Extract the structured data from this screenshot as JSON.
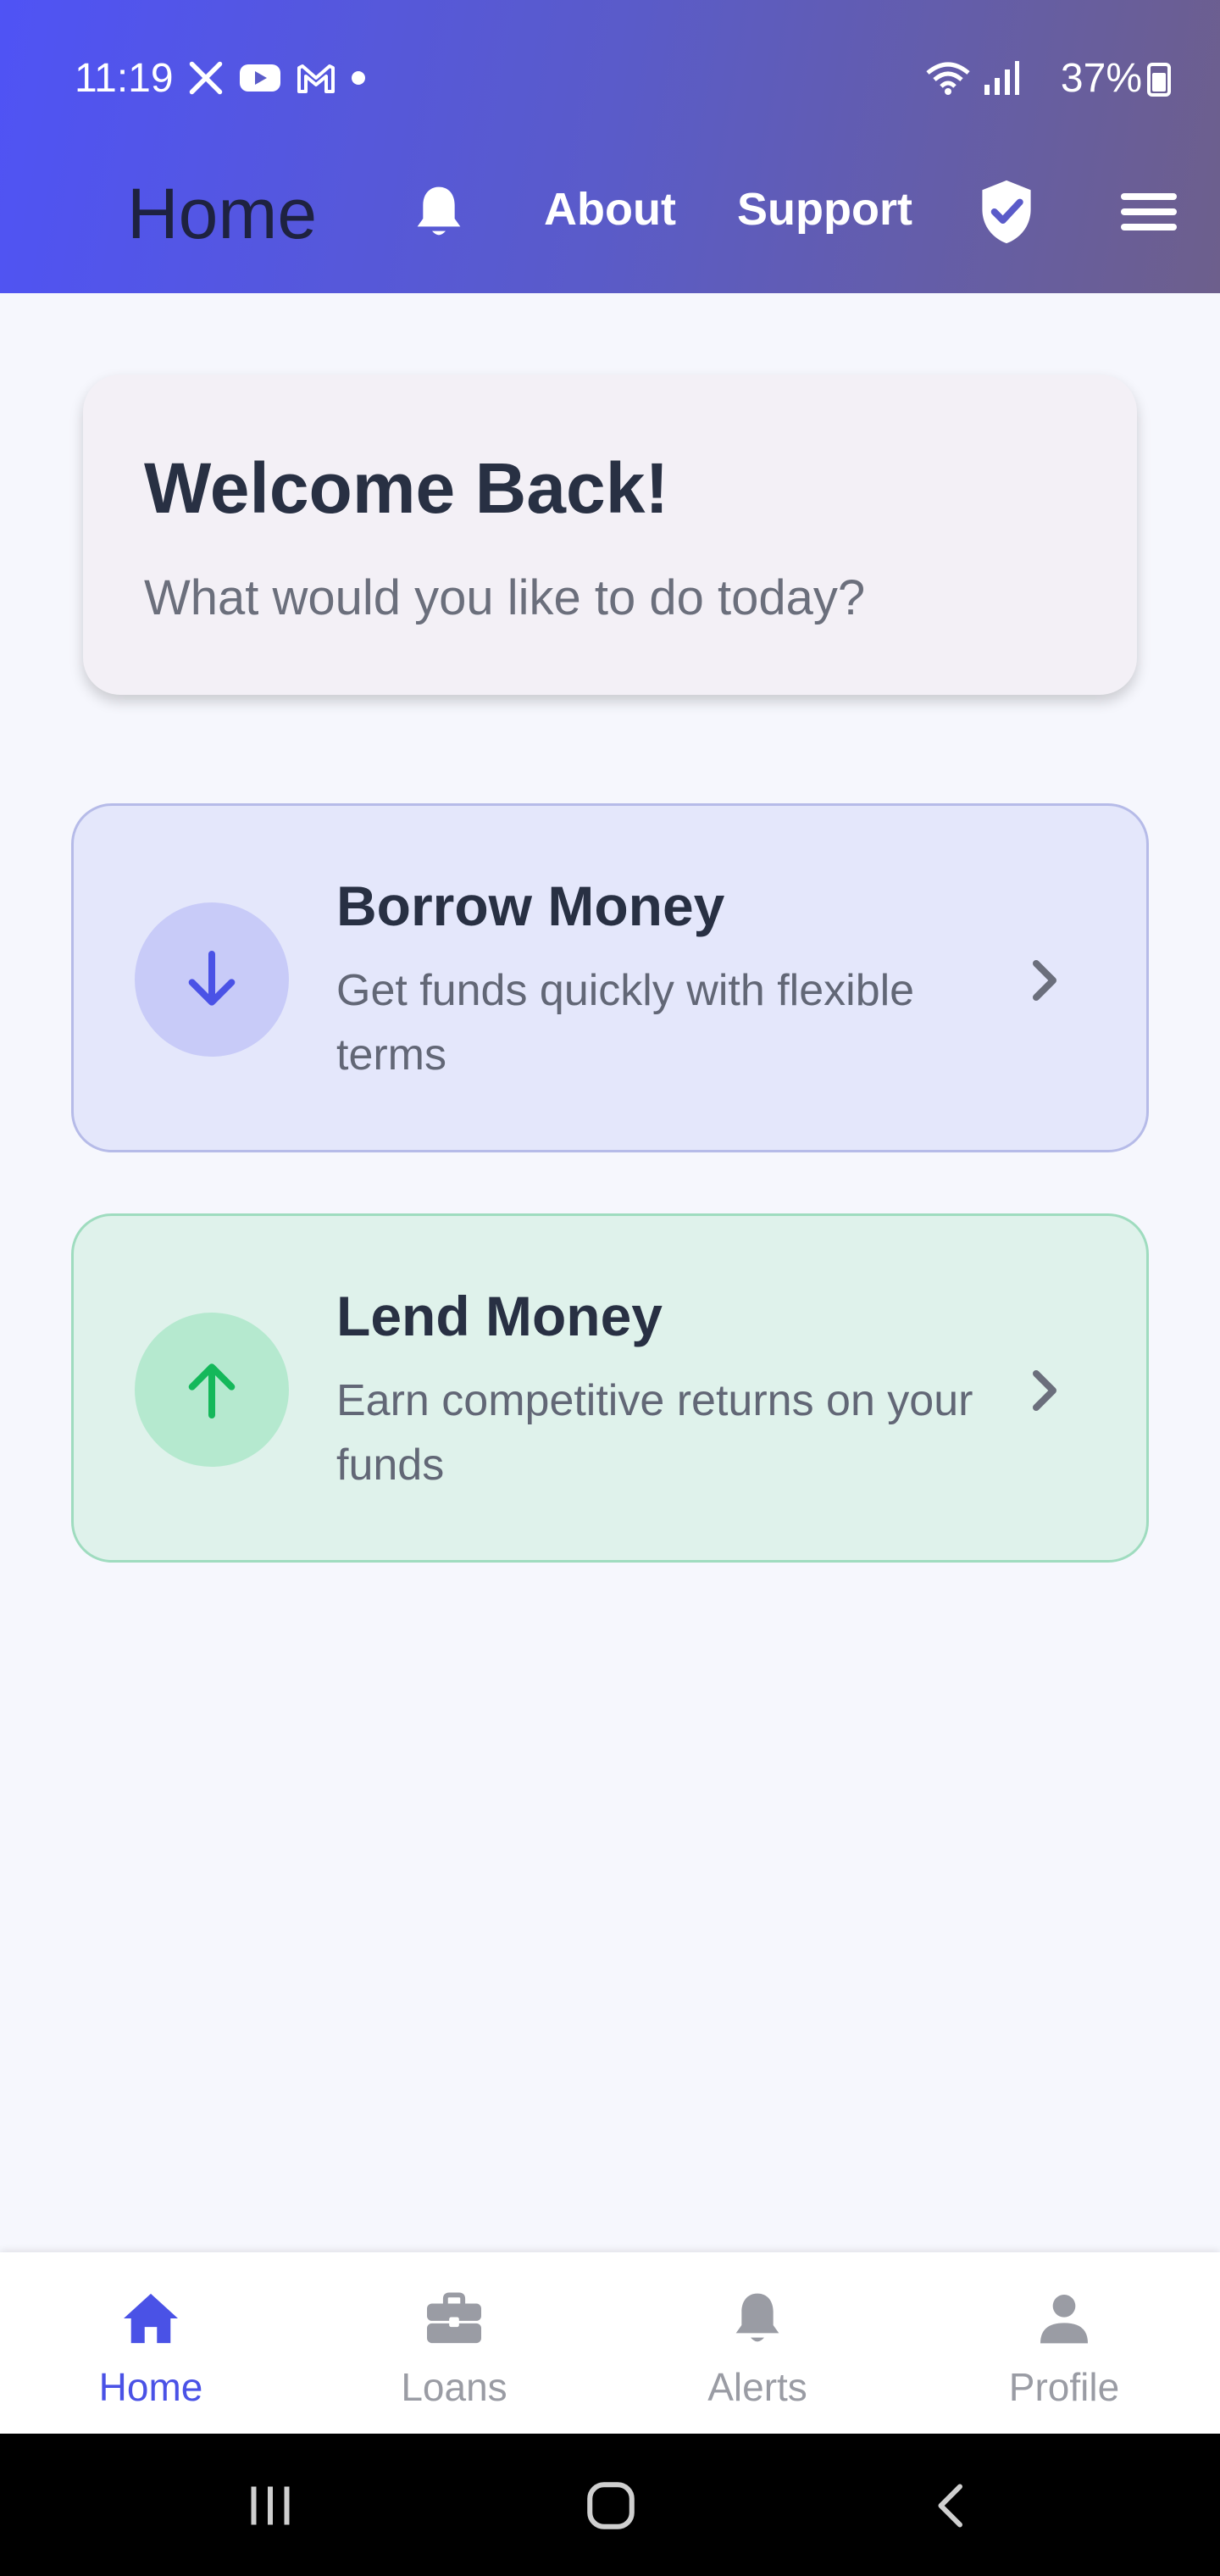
{
  "status_bar": {
    "time": "11:19",
    "battery": "37%",
    "icons": [
      "x-app-icon",
      "youtube-icon",
      "gmail-icon",
      "dot-icon",
      "wifi-icon",
      "signal-icon",
      "battery-icon"
    ]
  },
  "app_bar": {
    "title": "Home",
    "nav": {
      "about": "About",
      "support": "Support"
    },
    "icons": [
      "bell-icon",
      "shield-check-icon",
      "hamburger-menu-icon"
    ]
  },
  "welcome": {
    "title": "Welcome Back!",
    "subtitle": "What would you like to do today?"
  },
  "actions": [
    {
      "title": "Borrow Money",
      "description": "Get funds quickly with flexible terms",
      "icon": "arrow-down-icon",
      "accent": "#4a52e6"
    },
    {
      "title": "Lend Money",
      "description": "Earn competitive returns on your funds",
      "icon": "arrow-up-icon",
      "accent": "#14b85a"
    }
  ],
  "bottom_nav": [
    {
      "label": "Home",
      "icon": "home-icon",
      "active": true
    },
    {
      "label": "Loans",
      "icon": "briefcase-icon",
      "active": false
    },
    {
      "label": "Alerts",
      "icon": "bell-icon",
      "active": false
    },
    {
      "label": "Profile",
      "icon": "person-icon",
      "active": false
    }
  ],
  "colors": {
    "primary": "#4a52e6",
    "success": "#14b85a",
    "background": "#f6f7fd"
  }
}
